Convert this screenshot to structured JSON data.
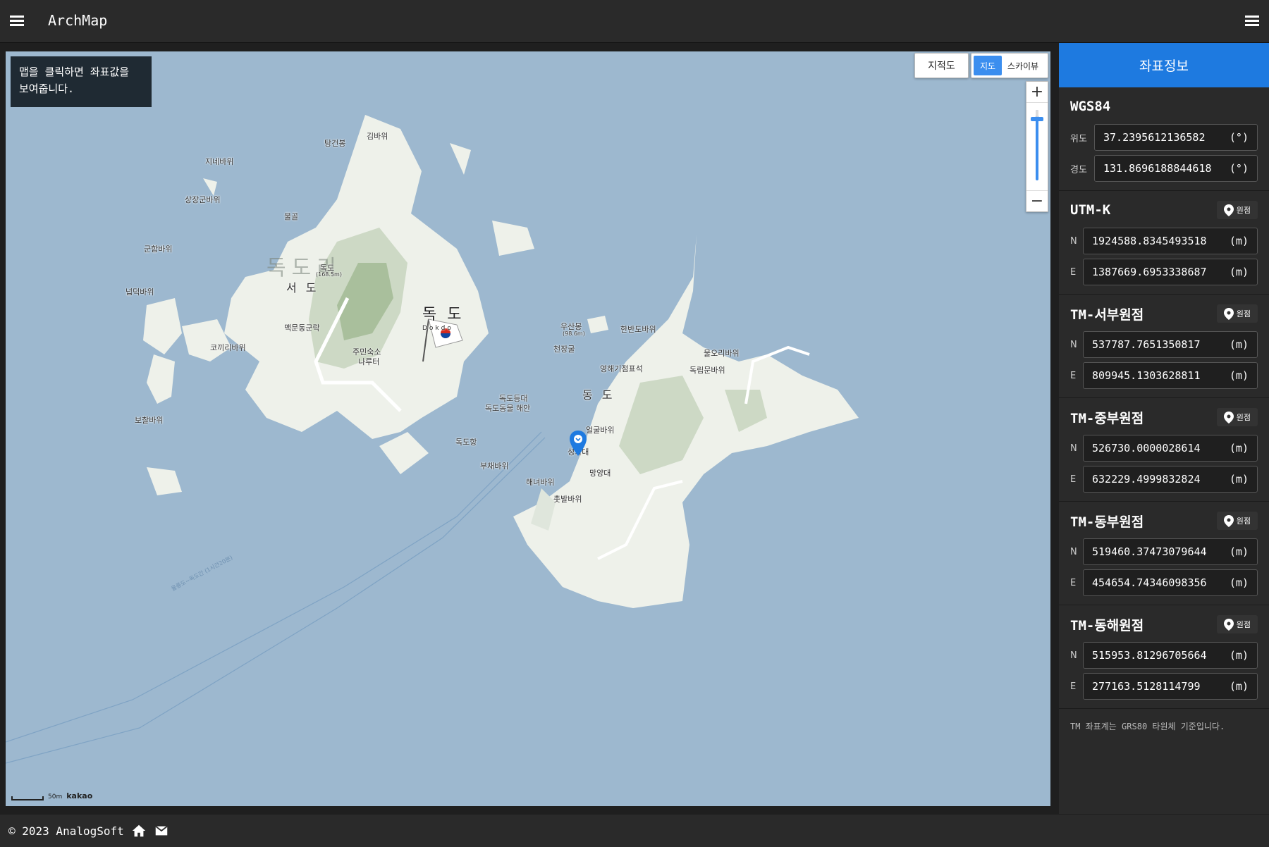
{
  "header": {
    "title": "ArchMap",
    "menu_left_icon": "hamburger-icon",
    "menu_right_icon": "hamburger-icon"
  },
  "map": {
    "hint": "맵을 클릭하면 좌표값을 보여줍니다.",
    "map_type_buttons": {
      "cadastral": "지적도",
      "map": "지도",
      "skyview": "스카이뷰",
      "active": "지도"
    },
    "zoom": {
      "in": "+",
      "out": "−"
    },
    "scale": {
      "label": "50m",
      "provider": "kakao"
    },
    "places": [
      "탕건봉",
      "김바위",
      "지네바위",
      "상장군바위",
      "물골",
      "군함바위",
      "독도리",
      "독도",
      "(168.5m)",
      "서 도",
      "넙덕바위",
      "맥문동군락",
      "코끼리바위",
      "주민숙소",
      "나루터",
      "보찰바위",
      "독 도",
      "Dokdo",
      "우산봉",
      "(98.6m)",
      "한반도바위",
      "천장굴",
      "영해기점표석",
      "물오리바위",
      "독립문바위",
      "동 도",
      "독도등대",
      "독도동물 해안",
      "얼굴바위",
      "독도항",
      "성화대",
      "부채바위",
      "망양대",
      "해녀바위",
      "촛발바위",
      "울릉도~독도간 (1시간20분)"
    ],
    "colors": {
      "sea": "#9db8cf",
      "land": "#eef1ea",
      "land_mid": "#cdd9c5",
      "land_dark": "#a9bf9c",
      "marker": "#1e7ae0"
    }
  },
  "sidebar": {
    "title": "좌표정보",
    "origin_label": "원점",
    "sections": [
      {
        "name": "WGS84",
        "rows": [
          {
            "label": "위도",
            "value": "37.2395612136582",
            "unit": "(°)"
          },
          {
            "label": "경도",
            "value": "131.8696188844618",
            "unit": "(°)"
          }
        ]
      },
      {
        "name": "UTM-K",
        "rows": [
          {
            "label": "N",
            "value": "1924588.8345493518",
            "unit": "(m)"
          },
          {
            "label": "E",
            "value": "1387669.6953338687",
            "unit": "(m)"
          }
        ]
      },
      {
        "name": "TM-서부원점",
        "rows": [
          {
            "label": "N",
            "value": "537787.7651350817",
            "unit": "(m)"
          },
          {
            "label": "E",
            "value": "809945.1303628811",
            "unit": "(m)"
          }
        ]
      },
      {
        "name": "TM-중부원점",
        "rows": [
          {
            "label": "N",
            "value": "526730.0000028614",
            "unit": "(m)"
          },
          {
            "label": "E",
            "value": "632229.4999832824",
            "unit": "(m)"
          }
        ]
      },
      {
        "name": "TM-동부원점",
        "rows": [
          {
            "label": "N",
            "value": "519460.37473079644",
            "unit": "(m)"
          },
          {
            "label": "E",
            "value": "454654.74346098356",
            "unit": "(m)"
          }
        ]
      },
      {
        "name": "TM-동해원점",
        "rows": [
          {
            "label": "N",
            "value": "515953.81296705664",
            "unit": "(m)"
          },
          {
            "label": "E",
            "value": "277163.5128114799",
            "unit": "(m)"
          }
        ]
      }
    ],
    "note": "TM 좌표계는 GRS80 타원체 기준입니다."
  },
  "footer": {
    "copyright": "© 2023 AnalogSoft",
    "home_icon": "home-icon",
    "mail_icon": "mail-icon"
  }
}
